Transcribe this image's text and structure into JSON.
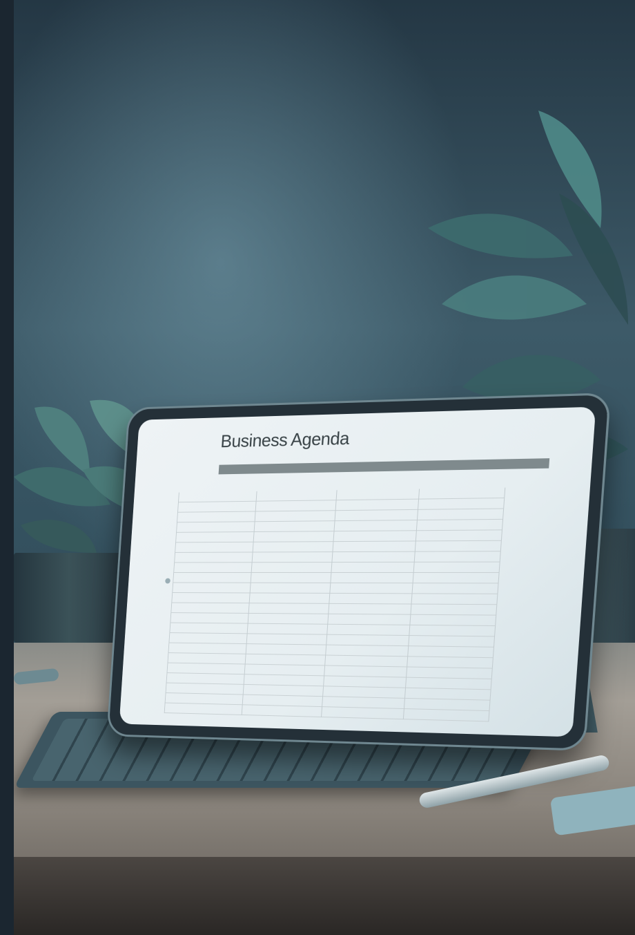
{
  "screen": {
    "title": "Business Agenda"
  },
  "colors": {
    "wall": "#33505e",
    "table": "#a39e96",
    "screen": "#eef3f5",
    "accent_bar": "#7f8a8d"
  }
}
